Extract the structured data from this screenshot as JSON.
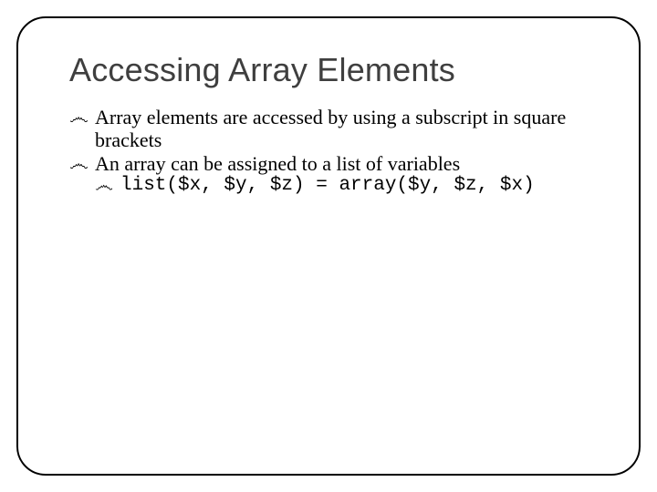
{
  "slide": {
    "title": "Accessing Array Elements",
    "bullets": [
      {
        "level": 1,
        "text": "Array elements are accessed by using a subscript in square brackets"
      },
      {
        "level": 1,
        "text": "An array can be assigned to a list of variables"
      },
      {
        "level": 2,
        "text": "list($x, $y, $z) = array($y, $z, $x)"
      }
    ],
    "bullet_glyph": "෴",
    "page_number": ""
  }
}
